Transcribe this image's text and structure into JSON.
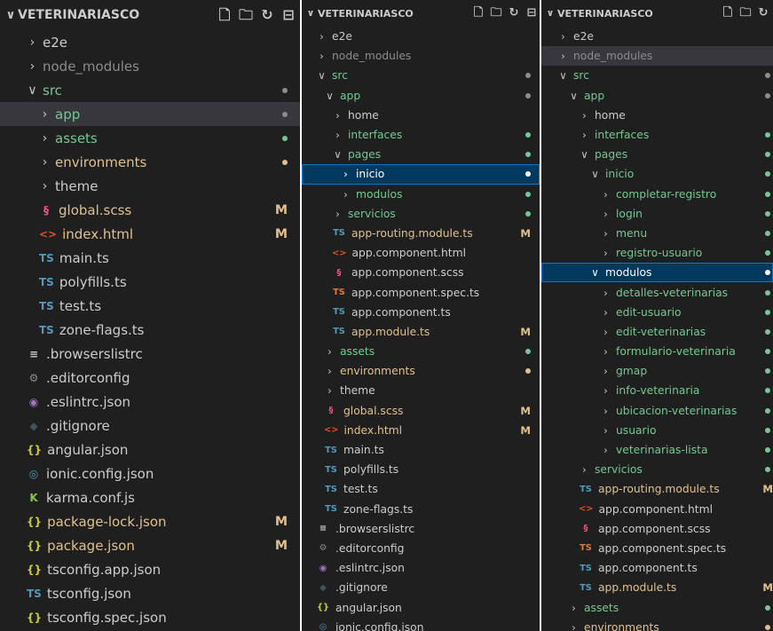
{
  "colors": {
    "background": "#1f1f1f",
    "selected_row": "#04395e",
    "selection_border": "#0078d4",
    "untracked_green": "#73c991",
    "modified_yellow": "#e2c08d",
    "ignored_gray": "#8c8c8c",
    "ts_icon": "#519aba",
    "scss_icon": "#f55385",
    "html_icon": "#e44d26",
    "json_icon": "#cbcb41"
  },
  "panes": [
    {
      "title": "VETERINARIASCO",
      "actions": [
        {
          "name": "new-file-icon",
          "glyph": "🗋"
        },
        {
          "name": "new-folder-icon",
          "glyph": "🗀"
        },
        {
          "name": "refresh-icon",
          "glyph": "↻"
        },
        {
          "name": "collapse-all-icon",
          "glyph": "⊟"
        }
      ],
      "items": [
        {
          "label": "e2e",
          "indent": 0,
          "type": "folder",
          "expanded": false,
          "color": "default"
        },
        {
          "label": "node_modules",
          "indent": 0,
          "type": "folder",
          "expanded": false,
          "color": "ignored"
        },
        {
          "label": "src",
          "indent": 0,
          "type": "folder",
          "expanded": true,
          "color": "green",
          "dot": "gray"
        },
        {
          "label": "app",
          "indent": 1,
          "type": "folder",
          "expanded": false,
          "color": "green",
          "dot": "gray",
          "state": "hl"
        },
        {
          "label": "assets",
          "indent": 1,
          "type": "folder",
          "expanded": false,
          "color": "green",
          "dot": "green"
        },
        {
          "label": "environments",
          "indent": 1,
          "type": "folder",
          "expanded": false,
          "color": "modified",
          "dot": "yellow"
        },
        {
          "label": "theme",
          "indent": 1,
          "type": "folder",
          "expanded": false,
          "color": "default"
        },
        {
          "label": "global.scss",
          "indent": 1,
          "type": "file",
          "icon": "§",
          "iconName": "sass-icon",
          "iconClass": "i-sass",
          "color": "modified",
          "badge": "M"
        },
        {
          "label": "index.html",
          "indent": 1,
          "type": "file",
          "icon": "<>",
          "iconName": "html-icon",
          "iconClass": "i-html",
          "color": "modified",
          "badge": "M"
        },
        {
          "label": "main.ts",
          "indent": 1,
          "type": "file",
          "icon": "TS",
          "iconName": "typescript-icon",
          "iconClass": "i-ts",
          "color": "default"
        },
        {
          "label": "polyfills.ts",
          "indent": 1,
          "type": "file",
          "icon": "TS",
          "iconName": "typescript-icon",
          "iconClass": "i-ts",
          "color": "default"
        },
        {
          "label": "test.ts",
          "indent": 1,
          "type": "file",
          "icon": "TS",
          "iconName": "typescript-icon",
          "iconClass": "i-ts",
          "color": "default"
        },
        {
          "label": "zone-flags.ts",
          "indent": 1,
          "type": "file",
          "icon": "TS",
          "iconName": "typescript-icon",
          "iconClass": "i-ts",
          "color": "default"
        },
        {
          "label": ".browserslistrc",
          "indent": 0,
          "type": "file",
          "icon": "≡",
          "iconName": "list-icon",
          "iconClass": "i-list",
          "color": "default"
        },
        {
          "label": ".editorconfig",
          "indent": 0,
          "type": "file",
          "icon": "⚙",
          "iconName": "gear-icon",
          "iconClass": "i-gear",
          "color": "default"
        },
        {
          "label": ".eslintrc.json",
          "indent": 0,
          "type": "file",
          "icon": "◉",
          "iconName": "eslint-icon",
          "iconClass": "i-eslint",
          "color": "default"
        },
        {
          "label": ".gitignore",
          "indent": 0,
          "type": "file",
          "icon": "◆",
          "iconName": "git-icon",
          "iconClass": "i-git",
          "color": "default"
        },
        {
          "label": "angular.json",
          "indent": 0,
          "type": "file",
          "icon": "{}",
          "iconName": "json-icon",
          "iconClass": "i-json",
          "color": "default"
        },
        {
          "label": "ionic.config.json",
          "indent": 0,
          "type": "file",
          "icon": "◎",
          "iconName": "ionic-icon",
          "iconClass": "i-ionic",
          "color": "default"
        },
        {
          "label": "karma.conf.js",
          "indent": 0,
          "type": "file",
          "icon": "K",
          "iconName": "karma-icon",
          "iconClass": "i-karma",
          "color": "default"
        },
        {
          "label": "package-lock.json",
          "indent": 0,
          "type": "file",
          "icon": "{}",
          "iconName": "json-icon",
          "iconClass": "i-json",
          "color": "modified",
          "badge": "M"
        },
        {
          "label": "package.json",
          "indent": 0,
          "type": "file",
          "icon": "{}",
          "iconName": "json-icon",
          "iconClass": "i-json",
          "color": "modified",
          "badge": "M"
        },
        {
          "label": "tsconfig.app.json",
          "indent": 0,
          "type": "file",
          "icon": "{}",
          "iconName": "json-icon",
          "iconClass": "i-json",
          "color": "default"
        },
        {
          "label": "tsconfig.json",
          "indent": 0,
          "type": "file",
          "icon": "TS",
          "iconName": "tsconfig-icon",
          "iconClass": "i-ts",
          "color": "default"
        },
        {
          "label": "tsconfig.spec.json",
          "indent": 0,
          "type": "file",
          "icon": "{}",
          "iconName": "json-icon",
          "iconClass": "i-json",
          "color": "default"
        }
      ]
    },
    {
      "title": "VETERINARIASCO",
      "actions": [
        {
          "name": "new-file-icon",
          "glyph": "🗋"
        },
        {
          "name": "new-folder-icon",
          "glyph": "🗀"
        },
        {
          "name": "refresh-icon",
          "glyph": "↻"
        },
        {
          "name": "collapse-all-icon",
          "glyph": "⊟"
        }
      ],
      "items": [
        {
          "label": "e2e",
          "indent": 0,
          "type": "folder",
          "expanded": false,
          "color": "default"
        },
        {
          "label": "node_modules",
          "indent": 0,
          "type": "folder",
          "expanded": false,
          "color": "ignored"
        },
        {
          "label": "src",
          "indent": 0,
          "type": "folder",
          "expanded": true,
          "color": "green",
          "dot": "gray"
        },
        {
          "label": "app",
          "indent": 1,
          "type": "folder",
          "expanded": true,
          "color": "green",
          "dot": "gray"
        },
        {
          "label": "home",
          "indent": 2,
          "type": "folder",
          "expanded": false,
          "color": "default"
        },
        {
          "label": "interfaces",
          "indent": 2,
          "type": "folder",
          "expanded": false,
          "color": "green",
          "dot": "green"
        },
        {
          "label": "pages",
          "indent": 2,
          "type": "folder",
          "expanded": true,
          "color": "green",
          "dot": "green"
        },
        {
          "label": "inicio",
          "indent": 3,
          "type": "folder",
          "expanded": false,
          "color": "white",
          "dot": "white",
          "state": "selected"
        },
        {
          "label": "modulos",
          "indent": 3,
          "type": "folder",
          "expanded": false,
          "color": "green",
          "dot": "green"
        },
        {
          "label": "servicios",
          "indent": 2,
          "type": "folder",
          "expanded": false,
          "color": "green",
          "dot": "green"
        },
        {
          "label": "app-routing.module.ts",
          "indent": 2,
          "type": "file",
          "icon": "TS",
          "iconName": "typescript-icon",
          "iconClass": "i-ts",
          "color": "modified",
          "badge": "M"
        },
        {
          "label": "app.component.html",
          "indent": 2,
          "type": "file",
          "icon": "<>",
          "iconName": "html-icon",
          "iconClass": "i-html",
          "color": "default"
        },
        {
          "label": "app.component.scss",
          "indent": 2,
          "type": "file",
          "icon": "§",
          "iconName": "sass-icon",
          "iconClass": "i-sass",
          "color": "default"
        },
        {
          "label": "app.component.spec.ts",
          "indent": 2,
          "type": "file",
          "icon": "TS",
          "iconName": "spec-icon",
          "iconClass": "i-spec",
          "color": "default"
        },
        {
          "label": "app.component.ts",
          "indent": 2,
          "type": "file",
          "icon": "TS",
          "iconName": "typescript-icon",
          "iconClass": "i-ts",
          "color": "default"
        },
        {
          "label": "app.module.ts",
          "indent": 2,
          "type": "file",
          "icon": "TS",
          "iconName": "typescript-icon",
          "iconClass": "i-ts",
          "color": "modified",
          "badge": "M"
        },
        {
          "label": "assets",
          "indent": 1,
          "type": "folder",
          "expanded": false,
          "color": "green",
          "dot": "green"
        },
        {
          "label": "environments",
          "indent": 1,
          "type": "folder",
          "expanded": false,
          "color": "modified",
          "dot": "yellow"
        },
        {
          "label": "theme",
          "indent": 1,
          "type": "folder",
          "expanded": false,
          "color": "default"
        },
        {
          "label": "global.scss",
          "indent": 1,
          "type": "file",
          "icon": "§",
          "iconName": "sass-icon",
          "iconClass": "i-sass",
          "color": "modified",
          "badge": "M"
        },
        {
          "label": "index.html",
          "indent": 1,
          "type": "file",
          "icon": "<>",
          "iconName": "html-icon",
          "iconClass": "i-html",
          "color": "modified",
          "badge": "M"
        },
        {
          "label": "main.ts",
          "indent": 1,
          "type": "file",
          "icon": "TS",
          "iconName": "typescript-icon",
          "iconClass": "i-ts",
          "color": "default"
        },
        {
          "label": "polyfills.ts",
          "indent": 1,
          "type": "file",
          "icon": "TS",
          "iconName": "typescript-icon",
          "iconClass": "i-ts",
          "color": "default"
        },
        {
          "label": "test.ts",
          "indent": 1,
          "type": "file",
          "icon": "TS",
          "iconName": "typescript-icon",
          "iconClass": "i-ts",
          "color": "default"
        },
        {
          "label": "zone-flags.ts",
          "indent": 1,
          "type": "file",
          "icon": "TS",
          "iconName": "typescript-icon",
          "iconClass": "i-ts",
          "color": "default"
        },
        {
          "label": ".browserslistrc",
          "indent": 0,
          "type": "file",
          "icon": "≡",
          "iconName": "list-icon",
          "iconClass": "i-list",
          "color": "default"
        },
        {
          "label": ".editorconfig",
          "indent": 0,
          "type": "file",
          "icon": "⚙",
          "iconName": "gear-icon",
          "iconClass": "i-gear",
          "color": "default"
        },
        {
          "label": ".eslintrc.json",
          "indent": 0,
          "type": "file",
          "icon": "◉",
          "iconName": "eslint-icon",
          "iconClass": "i-eslint",
          "color": "default"
        },
        {
          "label": ".gitignore",
          "indent": 0,
          "type": "file",
          "icon": "◆",
          "iconName": "git-icon",
          "iconClass": "i-git",
          "color": "default"
        },
        {
          "label": "angular.json",
          "indent": 0,
          "type": "file",
          "icon": "{}",
          "iconName": "json-icon",
          "iconClass": "i-json",
          "color": "default"
        },
        {
          "label": "ionic.config.json",
          "indent": 0,
          "type": "file",
          "icon": "◎",
          "iconName": "ionic-icon",
          "iconClass": "i-ionic",
          "color": "default"
        }
      ]
    },
    {
      "title": "VETERINARIASCO",
      "actions": [
        {
          "name": "new-file-icon",
          "glyph": "🗋"
        },
        {
          "name": "new-folder-icon",
          "glyph": "🗀"
        },
        {
          "name": "refresh-icon",
          "glyph": "↻"
        }
      ],
      "items": [
        {
          "label": "e2e",
          "indent": 0,
          "type": "folder",
          "expanded": false,
          "color": "default"
        },
        {
          "label": "node_modules",
          "indent": 0,
          "type": "folder",
          "expanded": false,
          "color": "ignored",
          "state": "hl"
        },
        {
          "label": "src",
          "indent": 0,
          "type": "folder",
          "expanded": true,
          "color": "green",
          "dot": "gray"
        },
        {
          "label": "app",
          "indent": 1,
          "type": "folder",
          "expanded": true,
          "color": "green",
          "dot": "gray"
        },
        {
          "label": "home",
          "indent": 2,
          "type": "folder",
          "expanded": false,
          "color": "default"
        },
        {
          "label": "interfaces",
          "indent": 2,
          "type": "folder",
          "expanded": false,
          "color": "green",
          "dot": "green"
        },
        {
          "label": "pages",
          "indent": 2,
          "type": "folder",
          "expanded": true,
          "color": "green",
          "dot": "green"
        },
        {
          "label": "inicio",
          "indent": 3,
          "type": "folder",
          "expanded": true,
          "color": "green",
          "dot": "green"
        },
        {
          "label": "completar-registro",
          "indent": 4,
          "type": "folder",
          "expanded": false,
          "color": "green",
          "dot": "green"
        },
        {
          "label": "login",
          "indent": 4,
          "type": "folder",
          "expanded": false,
          "color": "green",
          "dot": "green"
        },
        {
          "label": "menu",
          "indent": 4,
          "type": "folder",
          "expanded": false,
          "color": "green",
          "dot": "green"
        },
        {
          "label": "registro-usuario",
          "indent": 4,
          "type": "folder",
          "expanded": false,
          "color": "green",
          "dot": "green"
        },
        {
          "label": "modulos",
          "indent": 3,
          "type": "folder",
          "expanded": true,
          "color": "white",
          "dot": "white",
          "state": "selected"
        },
        {
          "label": "detalles-veterinarias",
          "indent": 4,
          "type": "folder",
          "expanded": false,
          "color": "green",
          "dot": "green"
        },
        {
          "label": "edit-usuario",
          "indent": 4,
          "type": "folder",
          "expanded": false,
          "color": "green",
          "dot": "green"
        },
        {
          "label": "edit-veterinarias",
          "indent": 4,
          "type": "folder",
          "expanded": false,
          "color": "green",
          "dot": "green"
        },
        {
          "label": "formulario-veterinaria",
          "indent": 4,
          "type": "folder",
          "expanded": false,
          "color": "green",
          "dot": "green"
        },
        {
          "label": "gmap",
          "indent": 4,
          "type": "folder",
          "expanded": false,
          "color": "green",
          "dot": "green"
        },
        {
          "label": "info-veterinaria",
          "indent": 4,
          "type": "folder",
          "expanded": false,
          "color": "green",
          "dot": "green"
        },
        {
          "label": "ubicacion-veterinarias",
          "indent": 4,
          "type": "folder",
          "expanded": false,
          "color": "green",
          "dot": "green"
        },
        {
          "label": "usuario",
          "indent": 4,
          "type": "folder",
          "expanded": false,
          "color": "green",
          "dot": "green"
        },
        {
          "label": "veterinarias-lista",
          "indent": 4,
          "type": "folder",
          "expanded": false,
          "color": "green",
          "dot": "green"
        },
        {
          "label": "servicios",
          "indent": 2,
          "type": "folder",
          "expanded": false,
          "color": "green",
          "dot": "green"
        },
        {
          "label": "app-routing.module.ts",
          "indent": 2,
          "type": "file",
          "icon": "TS",
          "iconName": "typescript-icon",
          "iconClass": "i-ts",
          "color": "modified",
          "badge": "M"
        },
        {
          "label": "app.component.html",
          "indent": 2,
          "type": "file",
          "icon": "<>",
          "iconName": "html-icon",
          "iconClass": "i-html",
          "color": "default"
        },
        {
          "label": "app.component.scss",
          "indent": 2,
          "type": "file",
          "icon": "§",
          "iconName": "sass-icon",
          "iconClass": "i-sass",
          "color": "default"
        },
        {
          "label": "app.component.spec.ts",
          "indent": 2,
          "type": "file",
          "icon": "TS",
          "iconName": "spec-icon",
          "iconClass": "i-spec",
          "color": "default"
        },
        {
          "label": "app.component.ts",
          "indent": 2,
          "type": "file",
          "icon": "TS",
          "iconName": "typescript-icon",
          "iconClass": "i-ts",
          "color": "default"
        },
        {
          "label": "app.module.ts",
          "indent": 2,
          "type": "file",
          "icon": "TS",
          "iconName": "typescript-icon",
          "iconClass": "i-ts",
          "color": "modified",
          "badge": "M"
        },
        {
          "label": "assets",
          "indent": 1,
          "type": "folder",
          "expanded": false,
          "color": "green",
          "dot": "green"
        },
        {
          "label": "environments",
          "indent": 1,
          "type": "folder",
          "expanded": false,
          "color": "modified",
          "dot": "yellow"
        }
      ]
    }
  ]
}
